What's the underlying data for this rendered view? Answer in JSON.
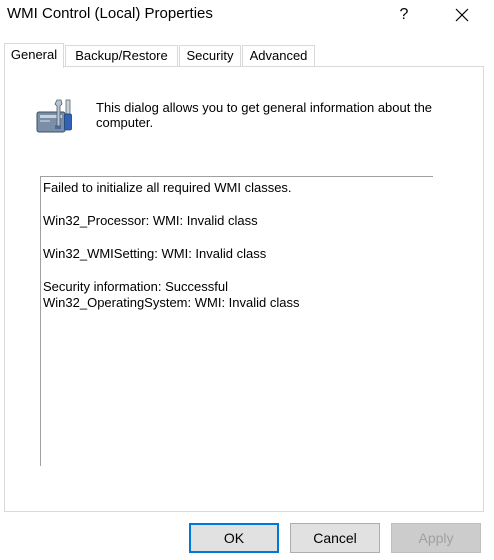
{
  "window": {
    "title": "WMI Control (Local) Properties",
    "help_glyph": "?",
    "close_icon": "close-icon"
  },
  "tabs": [
    {
      "label": "General",
      "selected": true
    },
    {
      "label": "Backup/Restore",
      "selected": false
    },
    {
      "label": "Security",
      "selected": false
    },
    {
      "label": "Advanced",
      "selected": false
    }
  ],
  "general": {
    "icon": "computer-management-icon",
    "description": "This dialog allows you to get general information about the computer.",
    "info_lines": [
      "Failed to initialize all required WMI classes.",
      "",
      "Win32_Processor: WMI: Invalid class",
      "",
      "Win32_WMISetting: WMI: Invalid class",
      "",
      "Security information: Successful",
      "Win32_OperatingSystem: WMI: Invalid class"
    ]
  },
  "buttons": {
    "ok": "OK",
    "cancel": "Cancel",
    "apply": "Apply",
    "apply_enabled": false
  },
  "colors": {
    "focus_border": "#0078d7",
    "button_face": "#e1e1e1",
    "disabled_text": "#a0a0a0"
  }
}
